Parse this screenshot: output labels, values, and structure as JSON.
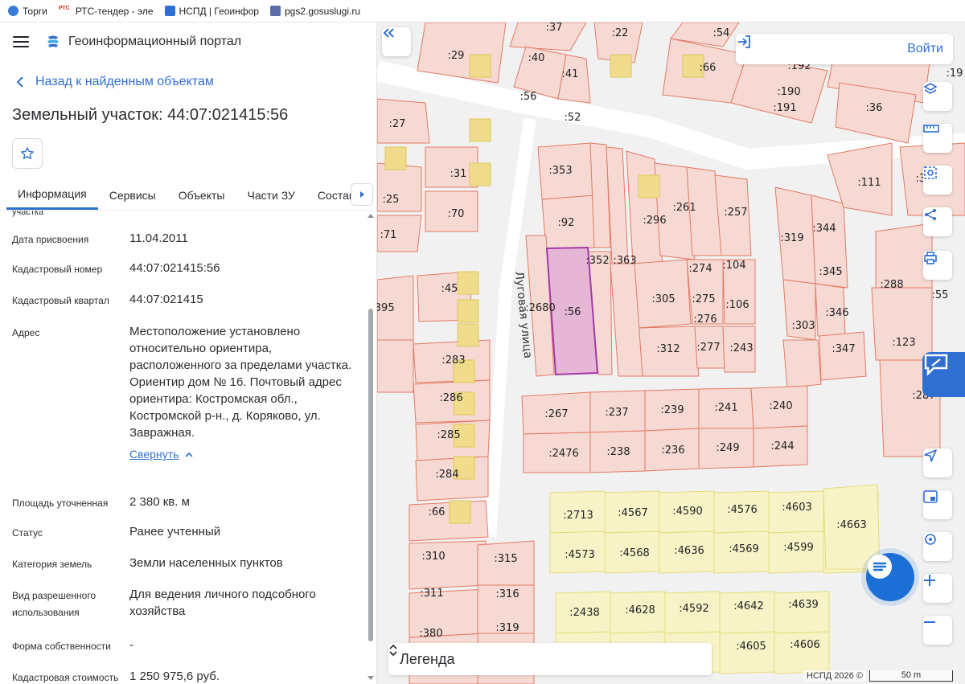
{
  "bookmarks": [
    {
      "label": "Торги",
      "color": "#3a7bd5"
    },
    {
      "label": "РТС-тендер - эле",
      "color": "#d8342b"
    },
    {
      "label": "НСПД | Геоинфор",
      "color": "#2f6fd1"
    },
    {
      "label": "pgs2.gosuslugi.ru",
      "color": "#5b6ea8"
    }
  ],
  "header": {
    "portal_title": "Геоинформационный портал",
    "back_label": "Назад к найденным объектам"
  },
  "object": {
    "title": "Земельный участок: 44:07:021415:56"
  },
  "tabs": [
    {
      "label": "Информация",
      "active": true
    },
    {
      "label": "Сервисы"
    },
    {
      "label": "Объекты"
    },
    {
      "label": "Части ЗУ"
    },
    {
      "label": "Состав"
    }
  ],
  "info": {
    "cut_label": "участка",
    "rows": [
      {
        "key": "Дата присвоения",
        "value": "11.04.2011"
      },
      {
        "key": "Кадастровый номер",
        "value": "44:07:021415:56"
      },
      {
        "key": "Кадастровый квартал",
        "value": "44:07:021415"
      },
      {
        "key": "Адрес",
        "value": "Местоположение установлено относительно ориентира, расположенного за пределами участка. Ориентир дом № 16. Почтовый адрес ориентира: Костромская обл., Костромской р-н., д. Коряково, ул. Завражная."
      },
      {
        "key": "Площадь уточненная",
        "value": "2 380 кв. м"
      },
      {
        "key": "Статус",
        "value": "Ранее учтенный"
      },
      {
        "key": "Категория земель",
        "value": "Земли населенных пунктов"
      },
      {
        "key": "Вид разрешенного использования",
        "value": "Для ведения личного подсобного хозяйства"
      },
      {
        "key": "Форма собственности",
        "value": "-"
      },
      {
        "key": "Кадастровая стоимость",
        "value": "1 250 975,6 руб."
      }
    ],
    "collapse_label": "Свернуть"
  },
  "map": {
    "login_label": "Войти",
    "legend_label": "Легенда",
    "attribution": "НСПД 2026 ©",
    "scale_label": "50 m",
    "street_label": "Луговая улица",
    "colors": {
      "parcel_fill": "#f6d9d3",
      "parcel_stroke": "#e37a63",
      "selected_fill": "#e6b6d6",
      "selected_stroke": "#a43aa6",
      "yellow_fill": "#f7f3c7",
      "yellow_stroke": "#e5dd7a",
      "building": "#f0dc8c",
      "accent": "#2f6fd1"
    }
  }
}
